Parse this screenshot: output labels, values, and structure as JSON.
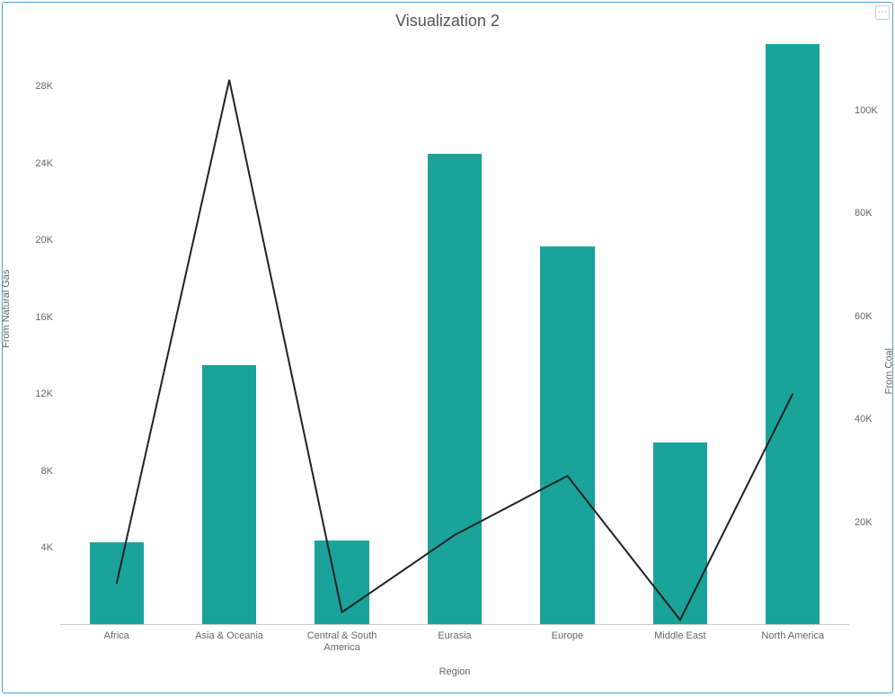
{
  "title": "Visualization 2",
  "options_icon": "more-options-icon",
  "axes": {
    "left": {
      "label": "From Natural Gas",
      "min": 0,
      "max": 30500,
      "ticks": [
        4000,
        8000,
        12000,
        16000,
        20000,
        24000,
        28000
      ],
      "tick_labels": [
        "4K",
        "8K",
        "12K",
        "16K",
        "20K",
        "24K",
        "28K"
      ]
    },
    "right": {
      "label": "From Coal",
      "min": 0,
      "max": 114000,
      "ticks": [
        20000,
        40000,
        60000,
        80000,
        100000
      ],
      "tick_labels": [
        "20K",
        "40K",
        "60K",
        "80K",
        "100K"
      ]
    },
    "x": {
      "label": "Region",
      "categories": [
        "Africa",
        "Asia & Oceania",
        "Central & South America",
        "Eurasia",
        "Europe",
        "Middle East",
        "North America"
      ]
    }
  },
  "chart_data": {
    "type": "bar+line",
    "categories": [
      "Africa",
      "Asia & Oceania",
      "Central & South America",
      "Eurasia",
      "Europe",
      "Middle East",
      "North America"
    ],
    "series": [
      {
        "name": "From Natural Gas",
        "type": "bar",
        "axis": "left",
        "color": "#1aa39a",
        "values": [
          4300,
          13500,
          4400,
          24500,
          19700,
          9500,
          30200
        ]
      },
      {
        "name": "From Coal",
        "type": "line",
        "axis": "right",
        "color": "#222222",
        "values": [
          8000,
          106000,
          2500,
          17500,
          29000,
          1000,
          45000
        ]
      }
    ],
    "title": "Visualization 2",
    "xlabel": "Region",
    "ylabel_left": "From Natural Gas",
    "ylabel_right": "From Coal"
  }
}
